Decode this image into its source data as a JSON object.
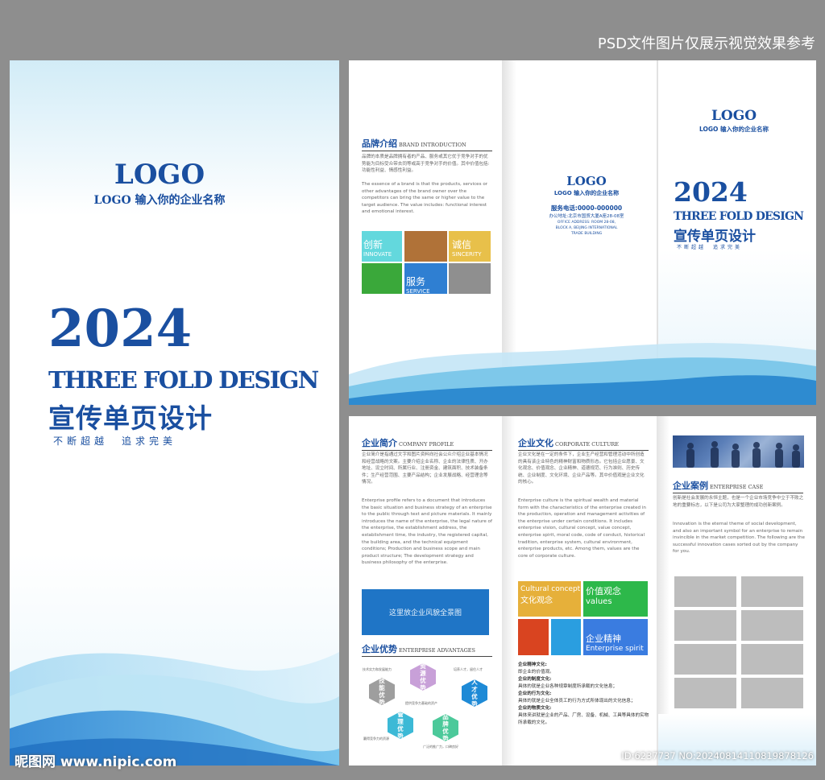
{
  "watermark_top": "PSD文件图片仅展示视觉效果参考",
  "watermark_bottom_left": "昵图网 www.nipic.com",
  "watermark_bottom_right": "ID:6237737 NO:20240814110819878126",
  "cover": {
    "logo": "LOGO",
    "logo_sub": "LOGO 输入你的企业名称",
    "year": "2024",
    "title_en": "THREE FOLD DESIGN",
    "title_cn": "宣传单页设计",
    "slogan": "不断超越　追求完美"
  },
  "outside": {
    "brand": {
      "head_cn": "品牌介绍",
      "head_en": "BRAND INTRODUCTION",
      "body_cn": "品牌的本质是品牌拥有者的产品、服务或其它优于竞争对手的优势能为目标受众带去同等或高于竞争对手的价值。其中价值包括:功能性利益、情感性利益。",
      "body_en": "The essence of a brand is that the products, services or other advantages of the brand owner over the competitors can bring the same or higher value to the target audience. The value includes: functional interest and emotional interest.",
      "tiles": [
        {
          "cn": "创新",
          "en": "INNOVATE"
        },
        {
          "cn": "诚信",
          "en": "SINCERITY"
        },
        {
          "cn": "服务",
          "en": "SERVICE"
        }
      ]
    },
    "contact": {
      "logo": "LOGO",
      "logo_sub": "LOGO 输入你的企业名称",
      "phone": "服务电话:0000-000000",
      "address": "办公地址:北京市国贸大厦A座28-08室",
      "address_en_1": "OFFICE ADDRESS: ROOM 28-08,",
      "address_en_2": "BLOCK A, BEIJING INTERNATIONAL",
      "address_en_3": "TRADE BUILDING"
    },
    "front": {
      "logo": "LOGO",
      "logo_sub": "LOGO 输入你的企业名称",
      "year": "2024",
      "title_en": "THREE FOLD DESIGN",
      "title_cn": "宣传单页设计",
      "slogan": "不断超越　追求完美"
    }
  },
  "inside": {
    "profile": {
      "head_cn": "企业简介",
      "head_en": "COMPANY PROFILE",
      "body_cn": "企业简介是指通过文字和图片资料向社会公众介绍企业基本情况和经营战略的文案。主要介绍企业名称、企业的法律性质、开办地址、设立时间、所属行业、注册资金、建筑面积、技术装备条件；生产经营范围、主要产品结构；企业发展战略、经营理念等情况。",
      "body_en": "Enterprise profile refers to a document that introduces the basic situation and business strategy of an enterprise to the public through text and picture materials. It mainly introduces the name of the enterprise, the legal nature of the enterprise, the establishment address, the establishment time, the industry, the registered capital, the building area, and the technical equipment conditions; Production and business scope and main product structure; The development strategy and business philosophy of the enterprise.",
      "image_placeholder": "这里放企业风貌全景图"
    },
    "advantages": {
      "head_cn": "企业优势",
      "head_en": "ENTERPRISE ADVANTAGES",
      "hexes": [
        {
          "label": "技能优势",
          "color": "#9e9e9e"
        },
        {
          "label": "资源优势",
          "color": "#c8a0d8"
        },
        {
          "label": "人才优势",
          "color": "#1e8ad6"
        },
        {
          "label": "管理优势",
          "color": "#3cb9d6"
        },
        {
          "label": "品牌优势",
          "color": "#4cc99a"
        }
      ],
      "notes": [
        "技术实力和发展能力",
        "培养人才，留住人才",
        "提供竞争力基础的资产",
        "赢得竞争力的资源",
        "广泛的推广力，口碑良好"
      ]
    },
    "culture": {
      "head_cn": "企业文化",
      "head_en": "CORPORATE CULTURE",
      "body_cn": "企业文化是在一定的条件下，企业生产经营和管理活动中所创造的具有该企业特色的精神财富和物质形态。它包括企业愿景、文化观念、价值观念、企业精神、道德规范、行为准则、历史传统、企业制度、文化环境、企业产品等。其中价值观是企业文化的核心。",
      "body_en": "Enterprise culture is the spiritual wealth and material form with the characteristics of the enterprise created in the production, operation and management activities of the enterprise under certain conditions. It includes enterprise vision, cultural concept, value concept, enterprise spirit, moral code, code of conduct, historical tradition, enterprise system, cultural environment, enterprise products, etc. Among them, values are the core of corporate culture.",
      "tiles": [
        {
          "line1": "Cultural concept",
          "line2": "文化观念",
          "color": "#e6b03a"
        },
        {
          "line1": "价值观念",
          "line2": "values",
          "color": "#2db84a"
        },
        {
          "line1": "企业精神",
          "line2": "Enterprise spirit",
          "color": "#3a7ce0"
        }
      ],
      "defs": [
        {
          "k": "企业精神文化:",
          "v": "即企业的价值观。"
        },
        {
          "k": "企业的制度文化:",
          "v": "具体的就是企业各种规章制度所承载的文化信息；"
        },
        {
          "k": "企业的行为文化:",
          "v": "具体的就是企业全体员工的行为方式所体现出的文化信息；"
        },
        {
          "k": "企业的物质文化:",
          "v": "具体来讲就是企业的产品、厂房、设备、机械、工具等具体的实物所承载的文化。"
        }
      ]
    },
    "cases": {
      "head_cn": "企业案例",
      "head_en": "ENTERPRISE CASE",
      "body_cn": "创新是社会发展的永恒主题，也是一个企业市场竞争中立于不败之地的重要标志，以下是公司为大家整理的成功创新案例。",
      "body_en": "Innovation is the eternal theme of social development, and also an important symbol for an enterprise to remain invincible in the market competition. The following are the successful innovation cases sorted out by the company for you."
    }
  }
}
